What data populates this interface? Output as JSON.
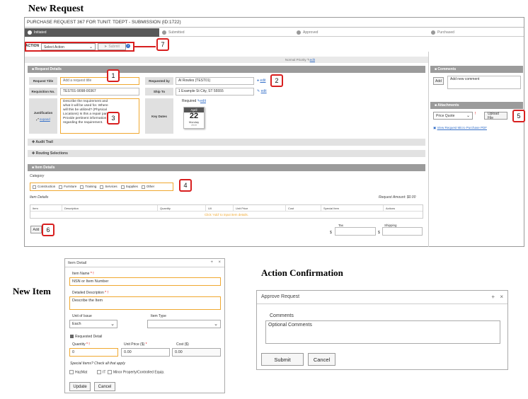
{
  "titles": {
    "new_request": "New Request",
    "new_item": "New Item",
    "action_confirmation": "Action Confirmation"
  },
  "header": {
    "title": "PURCHASE REQUEST 367 FOR TUNIT: TDEPT - SUBMISSION (ID:1722)"
  },
  "steps": [
    {
      "number": "1",
      "label": "Initiated",
      "active": true
    },
    {
      "number": "2",
      "label": "Submitted",
      "active": false
    },
    {
      "number": "3",
      "label": "Approved",
      "active": false
    },
    {
      "number": "4",
      "label": "Purchased",
      "active": false
    }
  ],
  "action_bar": {
    "label": "ACTION",
    "select_value": "Select Action",
    "submit_label": "Submit"
  },
  "priority": {
    "text": "Normal Priority",
    "edit": "edit"
  },
  "request_details": {
    "title": "Request Details",
    "request_title_label": "Request Title",
    "request_title_placeholder": "Add a request title",
    "requested_by_label": "Requested by",
    "requested_by_value": "Al Rowles (TEST01)",
    "requisition_label": "Requisition No.",
    "requisition_value": "TEST01-9098-00367",
    "ship_to_label": "Ship To",
    "ship_to_value": "1 Example St City, ST 55555",
    "edit": "edit",
    "justification_label": "Justification",
    "expand": "expand",
    "justification_text": "Describe the requirement and what it will be used for. Where will this be utilized? (Physical Locations) Is this a repair part? Provide pertinent information regarding the requirement.",
    "key_dates_label": "Key Dates",
    "required_label": "Required",
    "cal_month": "April",
    "cal_day": "22",
    "cal_weekday": "Monday",
    "cal_year": "2019"
  },
  "audit_trail": "Audit Trail",
  "routing_selections": "Routing Selections",
  "item_details": {
    "title": "Item Details",
    "category_label": "Category",
    "categories": [
      "Construction",
      "Furniture",
      "Training",
      "Services",
      "Supplies",
      "Other"
    ],
    "items_label": "Item Details",
    "request_amount_label": "Request Amount:",
    "request_amount_value": "$0.00",
    "columns": [
      "Item",
      "Description",
      "Quantity",
      "U/I",
      "Unit Price",
      "Cost",
      "Special Item",
      "Actions"
    ],
    "empty_message": "Click 'Add' to input item details.",
    "add_label": "Add",
    "tax_label": "Tax",
    "shipping_label": "Shipping",
    "currency": "$"
  },
  "comments": {
    "title": "Comments",
    "add_label": "Add",
    "placeholder": "Add new comment"
  },
  "attachments": {
    "title": "Attachments",
    "type_value": "Price Quote",
    "upload_label": "Upload File",
    "view_link": "View Request Micro Purchase PDF"
  },
  "callouts": [
    "1",
    "2",
    "3",
    "4",
    "5",
    "6",
    "7"
  ],
  "item_modal": {
    "title": "Item Detail",
    "item_name_label": "Item Name",
    "item_name_placeholder": "NSN or Item Number",
    "desc_label": "Detailed Description",
    "desc_placeholder": "Describe the Item",
    "unit_label": "Unit of Issue",
    "unit_value": "Each",
    "type_label": "Item Type",
    "requested_detail": "Requested Detail",
    "qty_label": "Quantity",
    "qty_value": "0",
    "price_label": "Unit Price ($)",
    "price_value": "0.00",
    "cost_label": "Cost ($)",
    "cost_value": "0.00",
    "special_label": "Special Items? Check all that apply",
    "specials": [
      "HazMat",
      "IT",
      "Minor Property/Controlled Equip."
    ],
    "update_label": "Update",
    "cancel_label": "Cancel",
    "required_mark": "!",
    "plus": "+",
    "close": "×"
  },
  "approve_modal": {
    "title": "Approve Request",
    "comments_label": "Comments",
    "comments_placeholder": "Optional Comments",
    "submit_label": "Submit",
    "cancel_label": "Cancel",
    "plus": "+",
    "close": "×"
  }
}
